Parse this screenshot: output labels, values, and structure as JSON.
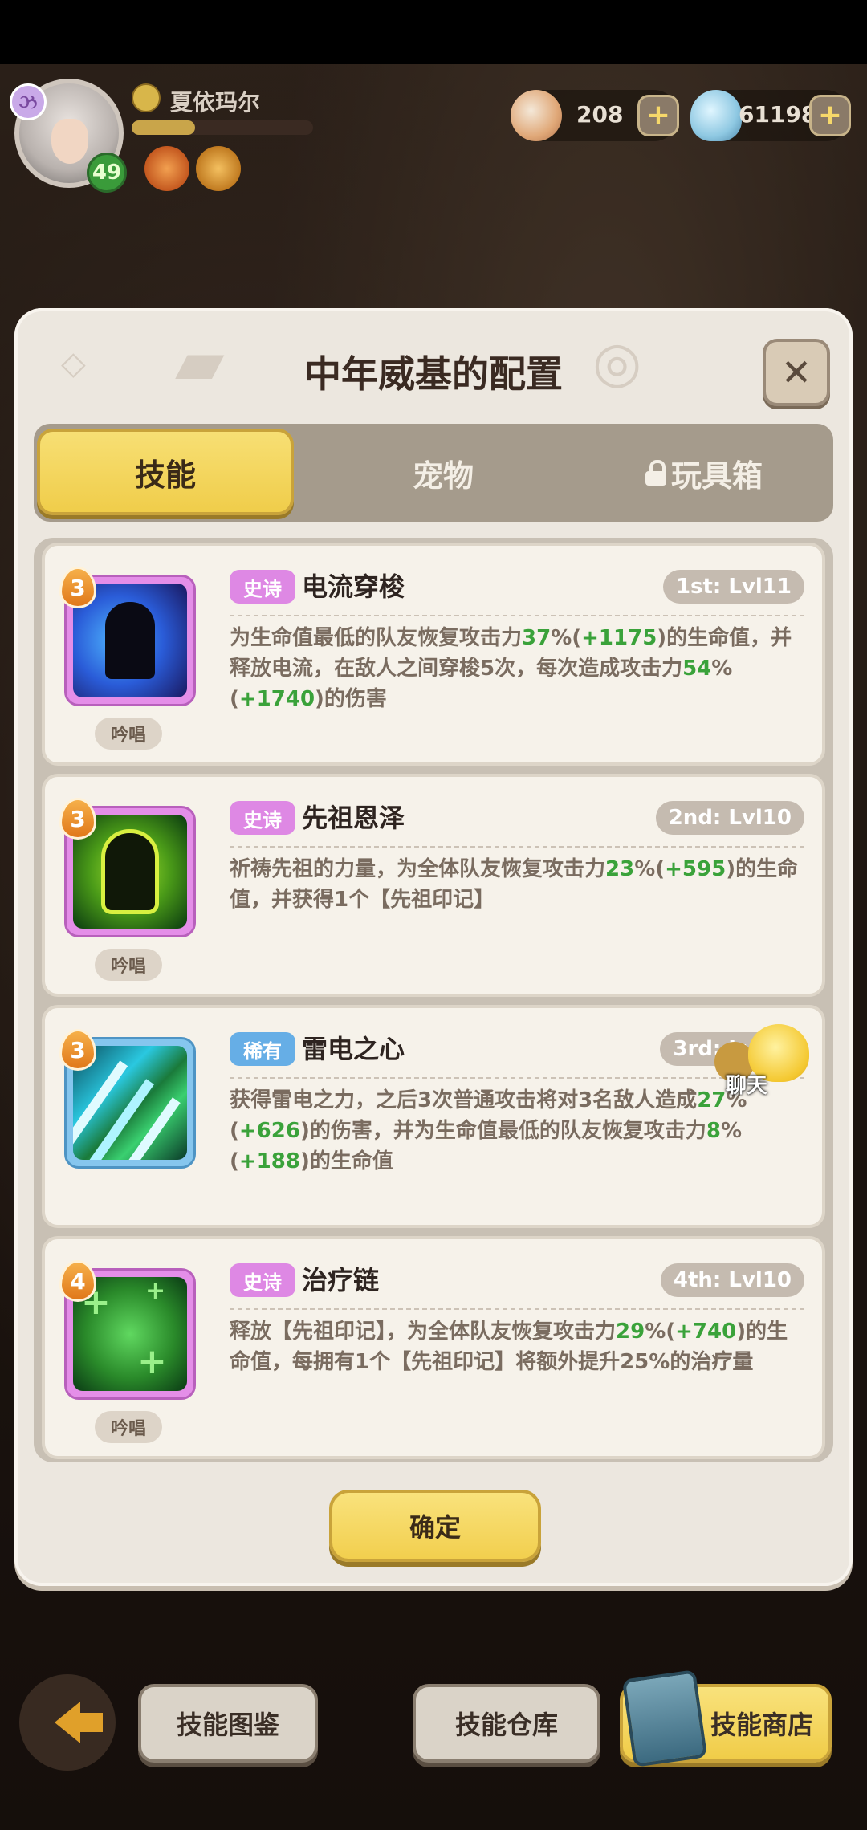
{
  "player": {
    "name": "夏依玛尔",
    "level": "49",
    "badge": "ઝ",
    "exp_fraction": 0.35
  },
  "currency": {
    "shells": "208",
    "gems": "611982",
    "plus": "+"
  },
  "modal": {
    "title": "中年威基的配置",
    "close": "✕",
    "tabs": [
      {
        "label": "技能",
        "selected": true
      },
      {
        "label": "宠物",
        "selected": false
      },
      {
        "label": "玩具箱",
        "selected": false,
        "locked": true
      }
    ],
    "confirm": "确定"
  },
  "skills": [
    {
      "level": "3",
      "rarity": "史诗",
      "name": "电流穿梭",
      "slot": "1st: Lvl11",
      "chant": "吟唱",
      "desc": [
        {
          "t": "为生命值最低的队友恢复攻击力"
        },
        {
          "t": "37",
          "g": true
        },
        {
          "t": "%("
        },
        {
          "t": "+1175",
          "g": true
        },
        {
          "t": ")的生命值，并释放电流，在敌人之间穿梭5次，每次造成攻击力"
        },
        {
          "t": "54",
          "g": true
        },
        {
          "t": "%("
        },
        {
          "t": "+1740",
          "g": true
        },
        {
          "t": ")的伤害"
        }
      ]
    },
    {
      "level": "3",
      "rarity": "史诗",
      "name": "先祖恩泽",
      "slot": "2nd: Lvl10",
      "chant": "吟唱",
      "desc": [
        {
          "t": "祈祷先祖的力量，为全体队友恢复攻击力"
        },
        {
          "t": "23",
          "g": true
        },
        {
          "t": "%("
        },
        {
          "t": "+595",
          "g": true
        },
        {
          "t": ")的生命值，并获得1个【先祖印记】"
        }
      ]
    },
    {
      "level": "3",
      "rarity": "稀有",
      "name": "雷电之心",
      "slot": "3rd: Lvl10",
      "chant": "",
      "desc": [
        {
          "t": "获得雷电之力，之后3次普通攻击将对3名敌人造成"
        },
        {
          "t": "27",
          "g": true
        },
        {
          "t": "%("
        },
        {
          "t": "+626",
          "g": true
        },
        {
          "t": ")的伤害，并为生命值最低的队友恢复攻击力"
        },
        {
          "t": "8",
          "g": true
        },
        {
          "t": "%("
        },
        {
          "t": "+188",
          "g": true
        },
        {
          "t": ")的生命值"
        }
      ]
    },
    {
      "level": "4",
      "rarity": "史诗",
      "name": "治疗链",
      "slot": "4th: Lvl10",
      "chant": "吟唱",
      "desc": [
        {
          "t": "释放【先祖印记】，为全体队友恢复攻击力"
        },
        {
          "t": "29",
          "g": true
        },
        {
          "t": "%("
        },
        {
          "t": "+740",
          "g": true
        },
        {
          "t": ")的生命值，每拥有1个【先祖印记】将额外提升25%的治疗量"
        }
      ]
    }
  ],
  "chat": {
    "label": "聊天"
  },
  "bottom": {
    "back": "back-arrow",
    "codex": "技能图鉴",
    "storage": "技能仓库",
    "shop": "技能商店"
  },
  "colors": {
    "accent_yellow": "#f2cf4e",
    "epic": "#de88e4",
    "rare": "#66aee6",
    "value_green": "#3aa23a"
  }
}
